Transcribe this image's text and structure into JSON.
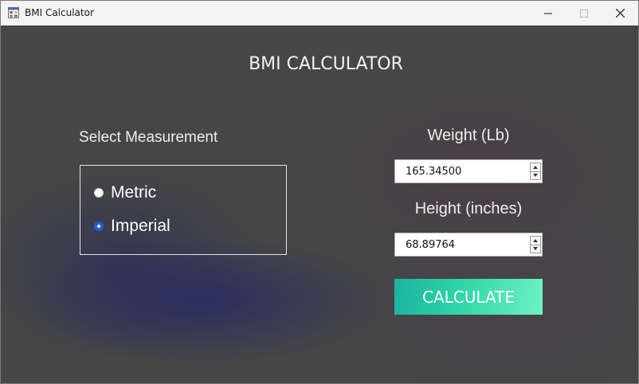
{
  "window": {
    "title": "BMI Calculator",
    "icon": "app-window-icon",
    "controls": {
      "minimize_icon": "minimize-icon",
      "maximize_icon": "maximize-icon",
      "close_icon": "close-icon"
    }
  },
  "app": {
    "heading": "BMI CALCULATOR",
    "select_label": "Select Measurement",
    "measurement_options": [
      {
        "label": "Metric",
        "selected": false
      },
      {
        "label": "Imperial",
        "selected": true
      }
    ],
    "weight": {
      "label": "Weight (Lb)",
      "value": "165.34500"
    },
    "height": {
      "label": "Height (inches)",
      "value": "68.89764"
    },
    "calculate_label": "CALCULATE"
  },
  "colors": {
    "background": "#464646",
    "accent_start": "#1bb3a0",
    "accent_end": "#6ef2c4",
    "radio_selected": "#1e5fd6"
  }
}
